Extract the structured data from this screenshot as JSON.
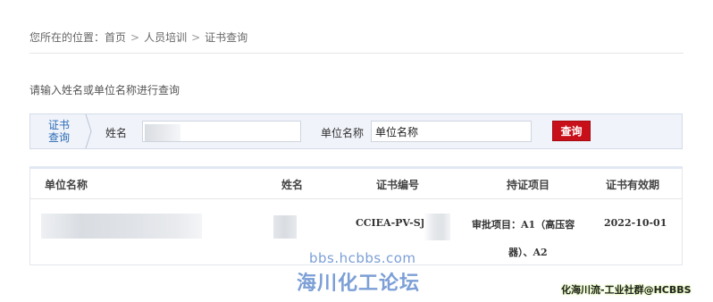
{
  "breadcrumb": {
    "prefix": "您所在的位置：",
    "items": [
      "首页",
      "人员培训",
      "证书查询"
    ],
    "separator": ">"
  },
  "hint": "请输入姓名或单位名称进行查询",
  "search": {
    "tag_line1": "证书",
    "tag_line2": "查询",
    "name_label": "姓名",
    "name_value": "",
    "unit_label": "单位名称",
    "unit_value": "单位名称",
    "button_label": "查询"
  },
  "table": {
    "columns": [
      "单位名称",
      "姓名",
      "证书编号",
      "持证项目",
      "证书有效期"
    ],
    "rows": [
      {
        "unit": "",
        "name": "",
        "cert_no": "CCIEA-PV-SJ",
        "project_line1": "审批项目：A1（高压容",
        "project_line2": "器）、A2",
        "expiry": "2022-10-01"
      }
    ]
  },
  "watermarks": {
    "site": "bbs.hcbbs.com",
    "forum": "海川化工论坛",
    "corner": "化海川流-工业社群@HCBBS"
  },
  "colors": {
    "accent_blue": "#2a6bb5",
    "button_red": "#c8101a",
    "panel_bg": "#f0f3fa",
    "watermark_blue": "#7c9fd6"
  }
}
